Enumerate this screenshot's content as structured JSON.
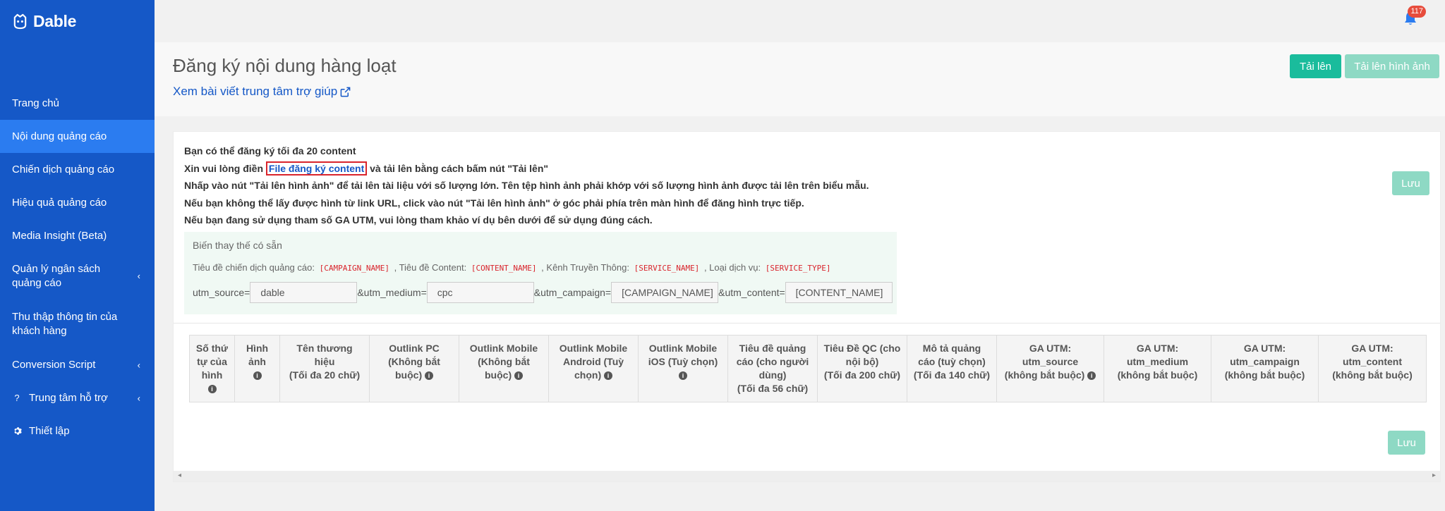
{
  "app": {
    "brand": "Dable"
  },
  "sidebar": {
    "items": [
      {
        "label": "Trang chủ"
      },
      {
        "label": "Nội dung quảng cáo",
        "active": true
      },
      {
        "label": "Chiến dịch quảng cáo"
      },
      {
        "label": "Hiệu quả quảng cáo"
      },
      {
        "label": "Media Insight (Beta)"
      },
      {
        "label": "Quản lý ngân sách quảng cáo",
        "icon": "chevron-left-icon"
      },
      {
        "label": "Thu thập thông tin của khách hàng"
      },
      {
        "label": "Conversion Script",
        "icon": "chevron-left-icon"
      },
      {
        "label": "Trung tâm hỗ trợ",
        "lead": "?",
        "icon": "chevron-left-icon"
      },
      {
        "label": "Thiết lập",
        "lead_icon": "gear-icon"
      }
    ],
    "chevron": "‹"
  },
  "topbar": {
    "notification_count": "117"
  },
  "header": {
    "title": "Đăng ký nội dung hàng loạt",
    "help_link": "Xem bài viết trung tâm trợ giúp",
    "upload_button": "Tải lên",
    "upload_image_button": "Tải lên hình ảnh"
  },
  "notes": {
    "line1": "Bạn có thể đăng ký tối đa 20 content",
    "line2_before": "Xin vui lòng điền",
    "line2_link": "File đăng ký content",
    "line2_after": "và tải lên bằng cách bấm nút \"Tải lên\"",
    "line3": "Nhấp vào nút \"Tải lên hình ảnh\" để tải lên tài liệu với số lượng lớn. Tên tệp hình ảnh phải khớp với số lượng hình ảnh được tải lên trên biểu mẫu.",
    "line4": "Nếu bạn không thể lấy được hình từ link URL, click vào nút \"Tải lên hình ảnh\" ở góc phải phía trên màn hình để đăng hình trực tiếp.",
    "line5": "Nếu bạn đang sử dụng tham số GA UTM, vui lòng tham khảo ví dụ bên dưới để sử dụng đúng cách."
  },
  "save_button": "Lưu",
  "variables": {
    "title": "Biến thay thế có sẵn",
    "campaign_label": "Tiêu đề chiến dịch quảng cáo:",
    "campaign_code": "[CAMPAIGN_NAME]",
    "content_label": ", Tiêu đề Content:",
    "content_code": "[CONTENT_NAME]",
    "service_label": ", Kênh Truyền Thông:",
    "service_code": "[SERVICE_NAME]",
    "type_label": ", Loại dịch vụ:",
    "type_code": "[SERVICE_TYPE]"
  },
  "utm": {
    "source_label": "utm_source=",
    "source_value": "dable",
    "medium_label": "&utm_medium=",
    "medium_value": "cpc",
    "campaign_label": "&utm_campaign=",
    "campaign_value": "[CAMPAIGN_NAME]",
    "content_label": "&utm_content=",
    "content_value": "[CONTENT_NAME]"
  },
  "table": {
    "columns": [
      {
        "lines": [
          "Số thứ",
          "tự của",
          "hình"
        ],
        "info": true
      },
      {
        "lines": [
          "Hình",
          "ảnh"
        ],
        "info": true
      },
      {
        "lines": [
          "Tên thương",
          "hiệu",
          "(Tối đa 20 chữ)"
        ]
      },
      {
        "lines": [
          "Outlink PC",
          "(Không bắt",
          "buộc)"
        ],
        "info": true
      },
      {
        "lines": [
          "Outlink Mobile",
          "(Không bắt",
          "buộc)"
        ],
        "info": true
      },
      {
        "lines": [
          "Outlink Mobile",
          "Android (Tuỳ",
          "chọn)"
        ],
        "info": true
      },
      {
        "lines": [
          "Outlink Mobile",
          "iOS (Tuỳ chọn)"
        ],
        "info": true
      },
      {
        "lines": [
          "Tiêu đề quảng",
          "cáo (cho người",
          "dùng)",
          "(Tối đa 56 chữ)"
        ]
      },
      {
        "lines": [
          "Tiêu Đề QC (cho",
          "nội bộ)",
          "(Tối đa 200 chữ)"
        ]
      },
      {
        "lines": [
          "Mô tả quảng",
          "cáo (tuỳ chọn)",
          "(Tối đa 140 chữ)"
        ]
      },
      {
        "lines": [
          "GA UTM:",
          "utm_source",
          "(không bắt buộc)"
        ],
        "info": true
      },
      {
        "lines": [
          "GA UTM:",
          "utm_medium",
          "(không bắt buộc)"
        ]
      },
      {
        "lines": [
          "GA UTM:",
          "utm_campaign",
          "(không bắt buộc)"
        ]
      },
      {
        "lines": [
          "GA UTM:",
          "utm_content",
          "(không bắt buộc)"
        ]
      }
    ]
  },
  "scroll": {
    "left": "◂",
    "right": "▸"
  }
}
